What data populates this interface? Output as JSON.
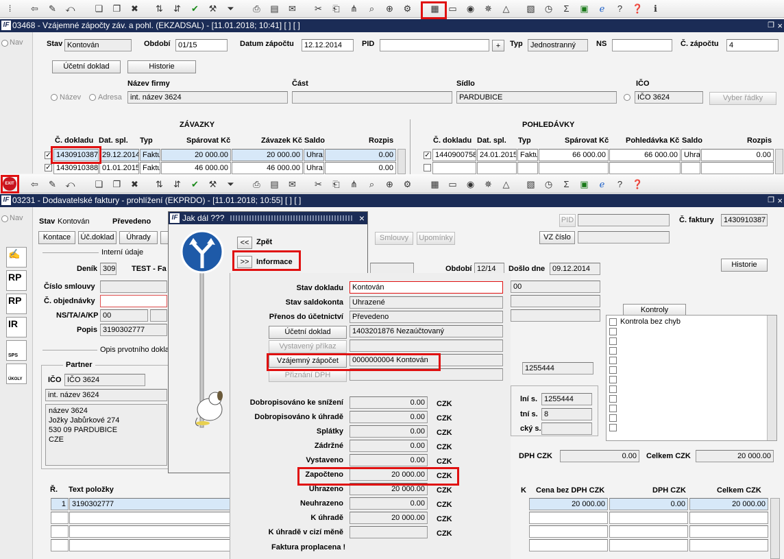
{
  "window1": {
    "title": "03468 - Vzájemné zápočty záv. a pohl. (EKZADSAL) - [11.01.2018; 10:41]  [ ]  [ ]",
    "nav_label": "Nav",
    "stav_label": "Stav",
    "stav_value": "Kontován",
    "obdobi_label": "Období",
    "obdobi_value": "01/15",
    "datum_label": "Datum zápočtu",
    "datum_value": "12.12.2014",
    "pid_label": "PID",
    "pid_value": "",
    "plus_label": "+",
    "typ_label": "Typ",
    "typ_value": "Jednostranný",
    "ns_label": "NS",
    "ns_value": "",
    "cislo_label": "Č. zápočtu",
    "cislo_value": "4",
    "ucetni_doklad_btn": "Účetní doklad",
    "historie_btn": "Historie",
    "nazev_firmy_label": "Název firmy",
    "cast_label": "Část",
    "sidlo_label": "Sídlo",
    "ico_label": "IČO",
    "radio_nazev": "Název",
    "radio_adresa": "Adresa",
    "nazev_firmy_value": "int. název 3624",
    "cast_value": "",
    "sidlo_value": "PARDUBICE",
    "ico_value": "IČO 3624",
    "vyber_radky_btn": "Vyber řádky",
    "zavazky": {
      "title": "ZÁVAZKY",
      "headers": [
        "Č. dokladu",
        "Dat. spl.",
        "Typ",
        "Spárovat Kč",
        "Závazek Kč",
        "Saldo",
        "Rozpis"
      ],
      "rows": [
        {
          "doklad": "1430910387",
          "datum": "29.12.2014",
          "typ": "Faktu",
          "sparovat": "20 000.00",
          "zavazek": "20 000.00",
          "saldo": "Uhra:",
          "rozpis": "0.00"
        },
        {
          "doklad": "1430910388",
          "datum": "01.01.2015",
          "typ": "Faktu",
          "sparovat": "46 000.00",
          "zavazek": "46 000.00",
          "saldo": "Uhra:",
          "rozpis": "0.00"
        }
      ]
    },
    "pohledavky": {
      "title": "POHLEDÁVKY",
      "headers": [
        "Č. dokladu",
        "Dat. spl.",
        "Typ",
        "Spárovat Kč",
        "Pohledávka Kč",
        "Saldo",
        "Rozpis"
      ],
      "rows": [
        {
          "doklad": "1440900758",
          "datum": "24.01.2015",
          "typ": "Faktu",
          "sparovat": "66 000.00",
          "pohledavka": "66 000.00",
          "saldo": "Uhra:",
          "rozpis": "0.00"
        }
      ]
    }
  },
  "window2": {
    "title": "03231 - Dodavatelské faktury - prohlížení (EKPRDO) - [11.01.2018; 10:55]  [ ]  [ ]",
    "nav_label": "Nav",
    "stav_label": "Stav",
    "stav_value": "Kontován",
    "prevedeno": "Převedeno",
    "pid_label": "PID",
    "pid_value": "",
    "cislo_faktury_label": "Č. faktury",
    "cislo_faktury_value": "1430910387",
    "buttons": {
      "kontace": "Kontace",
      "ucdoklad": "Úč.doklad",
      "uhrady": "Úhrady",
      "smlouvy": "Smlouvy",
      "upominky": "Upomínky",
      "vz_cislo": "VZ číslo",
      "historie": "Historie",
      "kontroly": "Kontroly"
    },
    "interni_udaje": "Interní údaje",
    "denik_label": "Deník",
    "denik_value": "309",
    "denik_text": "TEST - Fa",
    "cislo_smlouvy_label": "Číslo smlouvy",
    "cislo_objednavky_label": "Č. objednávky",
    "ns_label": "NS/TA/A/KP",
    "ns_value": "00",
    "popis_label": "Popis",
    "popis_value": "3190302777",
    "opis_label": "Opis prvotního dokla",
    "partner_label": "Partner",
    "ico_label": "IČO",
    "ico_value": "IČO 3624",
    "partner_name": "int. název 3624",
    "address": [
      "název 3624",
      "Jožky Jabůrkové 274",
      "530 09 PARDUBICE",
      "CZE"
    ],
    "obdobi_label": "Období",
    "obdobi_value": "12/14",
    "doslo_label": "Došlo dne",
    "doslo_value": "09.12.2014",
    "right_fields": [
      "00",
      "1255444",
      "1255444",
      "8"
    ],
    "right_labels": [
      "lní s.",
      "tní s.",
      "cký s."
    ],
    "kontrola_bez_chyb": "Kontrola bez chyb",
    "dph_czk": "DPH  CZK",
    "dph_value": "0.00",
    "celkem_czk": "Celkem  CZK",
    "celkem_value": "20 000.00",
    "items": {
      "headers": [
        "Ř.",
        "Text položky",
        "Cena bez DPH  CZK",
        "DPH  CZK",
        "Celkem  CZK"
      ],
      "k_fragment": "K",
      "row": {
        "r": "1",
        "text": "3190302777",
        "cena": "20 000.00",
        "dph": "0.00",
        "celkem": "20 000.00"
      }
    },
    "side_icons": [
      "RP",
      "RP",
      "IR",
      "SPS",
      "ÚKOLY"
    ]
  },
  "dialog": {
    "title": "Jak dál ???",
    "zpet_btn": "<<",
    "zpet_label": "Zpět",
    "info_btn": ">>",
    "info_label": "Informace"
  },
  "info": {
    "stav_dokladu_label": "Stav dokladu",
    "stav_dokladu_value": "Kontován",
    "stav_saldokonta_label": "Stav saldokonta",
    "stav_saldokonta_value": "Uhrazené",
    "prenos_label": "Přenos do účetnictví",
    "prenos_value": "Převedeno",
    "ucetni_doklad_btn": "Účetní doklad",
    "ucetni_doklad_value": "1403201876 Nezaúčtovaný",
    "vystaveny_prikaz_btn": "Vystavený příkaz",
    "vystaveny_prikaz_value": "",
    "vzajemny_zapocet_btn": "Vzájemný zápočet",
    "vzajemny_zapocet_value": "0000000004 Kontován",
    "priznani_dph_btn": "Přiznání DPH",
    "priznani_dph_value": "",
    "currency": "CZK",
    "amounts": [
      {
        "label": "Dobropisováno ke snížení",
        "value": "0.00"
      },
      {
        "label": "Dobropisováno k úhradě",
        "value": "0.00"
      },
      {
        "label": "Splátky",
        "value": "0.00"
      },
      {
        "label": "Zádržné",
        "value": "0.00"
      },
      {
        "label": "Vystaveno",
        "value": "0.00"
      },
      {
        "label": "Započteno",
        "value": "20 000.00"
      },
      {
        "label": "Uhrazeno",
        "value": "20 000.00"
      },
      {
        "label": "Neuhrazeno",
        "value": "0.00"
      },
      {
        "label": "K úhradě",
        "value": "20 000.00"
      },
      {
        "label": "K úhradě v cizí měně",
        "value": ""
      }
    ],
    "footer": "Faktura proplacena !"
  },
  "colors": {
    "titlebar": "#1b2c56",
    "highlight": "#e01010",
    "selected_row": "#d7e8f8"
  }
}
